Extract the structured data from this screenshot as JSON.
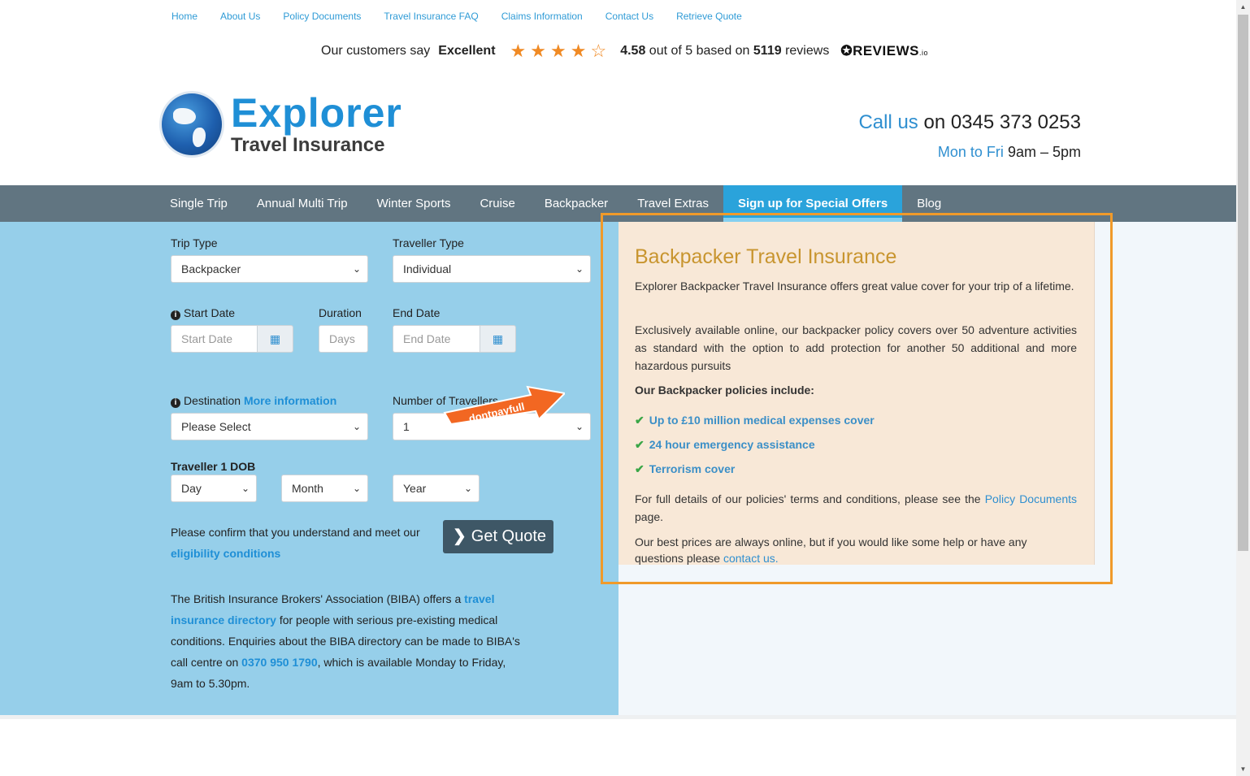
{
  "topnav": [
    "Home",
    "About Us",
    "Policy Documents",
    "Travel Insurance FAQ",
    "Claims Information",
    "Contact Us",
    "Retrieve Quote"
  ],
  "reviews": {
    "prefix": "Our customers say",
    "rating_word": "Excellent",
    "score": "4.58",
    "out_of": "out of 5 based on",
    "count": "5119",
    "reviews_word": "reviews",
    "brand": "REVIEWS",
    "brand_suffix": ".io",
    "stars": 4.5
  },
  "logo": {
    "title": "Explorer",
    "subtitle": "Travel Insurance"
  },
  "contact": {
    "call_label": "Call us",
    "call_on": "on 0345 373 0253",
    "days": "Mon to Fri",
    "hours": "9am – 5pm"
  },
  "mainnav": [
    "Single Trip",
    "Annual Multi Trip",
    "Winter Sports",
    "Cruise",
    "Backpacker",
    "Travel Extras",
    "Sign up for Special Offers",
    "Blog"
  ],
  "form": {
    "trip_type_label": "Trip Type",
    "trip_type_value": "Backpacker",
    "traveller_type_label": "Traveller Type",
    "traveller_type_value": "Individual",
    "start_date_label": "Start Date",
    "start_date_placeholder": "Start Date",
    "duration_label": "Duration",
    "duration_placeholder": "Days",
    "end_date_label": "End Date",
    "end_date_placeholder": "End Date",
    "destination_label": "Destination",
    "destination_link": "More information",
    "destination_value": "Please Select",
    "num_travellers_label": "Number of Travellers",
    "num_travellers_value": "1",
    "dob_label": "Traveller 1 DOB",
    "day": "Day",
    "month": "Month",
    "year": "Year",
    "confirm_text": "Please confirm that you understand and meet our",
    "eligibility_link": "eligibility conditions",
    "quote_button": "Get Quote",
    "badge_text": "dontpayfull"
  },
  "biba": {
    "t1": "The British Insurance Brokers' Association (BIBA) offers a",
    "link1": "travel insurance directory",
    "t2": "for people with serious pre-existing medical conditions. Enquiries about the BIBA directory can be made to BIBA's call centre on",
    "phone": "0370 950 1790",
    "t3": ", which is available Monday to Friday, 9am to 5.30pm."
  },
  "panel": {
    "title": "Backpacker Travel Insurance",
    "p1": "Explorer Backpacker Travel Insurance offers great value cover for your trip of a lifetime.",
    "p2": "Exclusively available online, our backpacker policy covers over 50 adventure activities as standard with the option to add protection for another 50 additional and more hazardous pursuits",
    "includes": "Our Backpacker policies include:",
    "items": [
      "Up to £10 million medical expenses cover",
      "24 hour emergency assistance",
      "Terrorism cover"
    ],
    "p3_a": "For full details of our policies' terms and conditions, please see the",
    "p3_link": "Policy Documents",
    "p3_b": "page.",
    "p4_a": "Our best prices are always online, but if you would like some help or have any questions please",
    "p4_link": "contact us."
  },
  "colors": {
    "accent": "#1f8fd6",
    "nav": "#617581",
    "active_nav": "#2aa3db",
    "form_bg": "#96cfea",
    "panel_bg": "#f8e8d7",
    "panel_border": "#f09a2a",
    "star": "#f08a24"
  }
}
